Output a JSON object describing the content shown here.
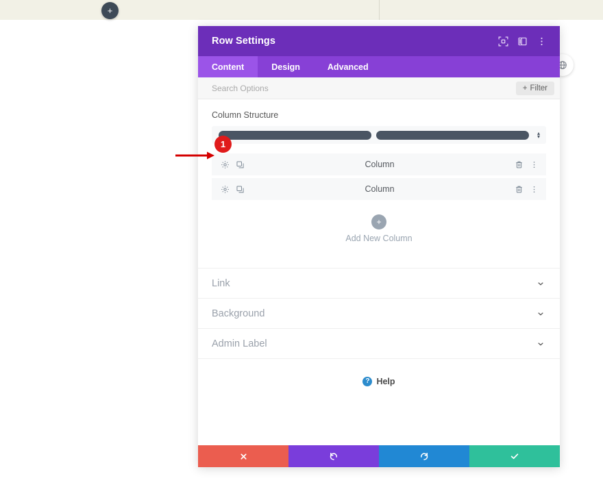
{
  "page": {
    "add_module_button_glyph": "+",
    "globe_badge_icon": "globe-icon"
  },
  "modal": {
    "title": "Row Settings",
    "header_icons": [
      {
        "name": "fullscreen-icon",
        "label": "Fullscreen"
      },
      {
        "name": "layout-view-icon",
        "label": "View Mode"
      },
      {
        "name": "more-vertical-icon",
        "label": "More Options"
      }
    ],
    "tabs": [
      {
        "label": "Content",
        "active": true
      },
      {
        "label": "Design",
        "active": false
      },
      {
        "label": "Advanced",
        "active": false
      }
    ],
    "search": {
      "placeholder": "Search Options",
      "value": ""
    },
    "filter_button": {
      "plus": "+",
      "label": "Filter"
    },
    "column_structure": {
      "label": "Column Structure",
      "bars": [
        {
          "flex": 1
        },
        {
          "flex": 1
        }
      ],
      "select_arrows_up": "▴",
      "select_arrows_down": "▾"
    },
    "columns": [
      {
        "title": "Column",
        "settings_icon": "gear-icon",
        "duplicate_icon": "duplicate-icon",
        "delete_icon": "trash-icon",
        "more_icon": "more-vertical-icon"
      },
      {
        "title": "Column",
        "settings_icon": "gear-icon",
        "duplicate_icon": "duplicate-icon",
        "delete_icon": "trash-icon",
        "more_icon": "more-vertical-icon"
      }
    ],
    "add_new_column": {
      "glyph": "+",
      "label": "Add New Column"
    },
    "accordions": [
      {
        "label": "Link",
        "chevron": "⌄"
      },
      {
        "label": "Background",
        "chevron": "⌄"
      },
      {
        "label": "Admin Label",
        "chevron": "⌄"
      }
    ],
    "help": {
      "glyph": "?",
      "label": "Help"
    },
    "footer_buttons": [
      {
        "name": "cancel-button",
        "icon": "close-icon",
        "glyph": "✖",
        "color": "#eb5d4f"
      },
      {
        "name": "undo-button",
        "icon": "undo-icon",
        "glyph": "↺",
        "color": "#7a3ddb"
      },
      {
        "name": "redo-button",
        "icon": "redo-icon",
        "glyph": "↻",
        "color": "#2188d4"
      },
      {
        "name": "save-button",
        "icon": "checkmark-icon",
        "glyph": "✔",
        "color": "#2fc09b"
      }
    ]
  },
  "annotation": {
    "badge_number": "1",
    "arrow_color": "#d40000",
    "badge_color": "#e01b1b"
  }
}
